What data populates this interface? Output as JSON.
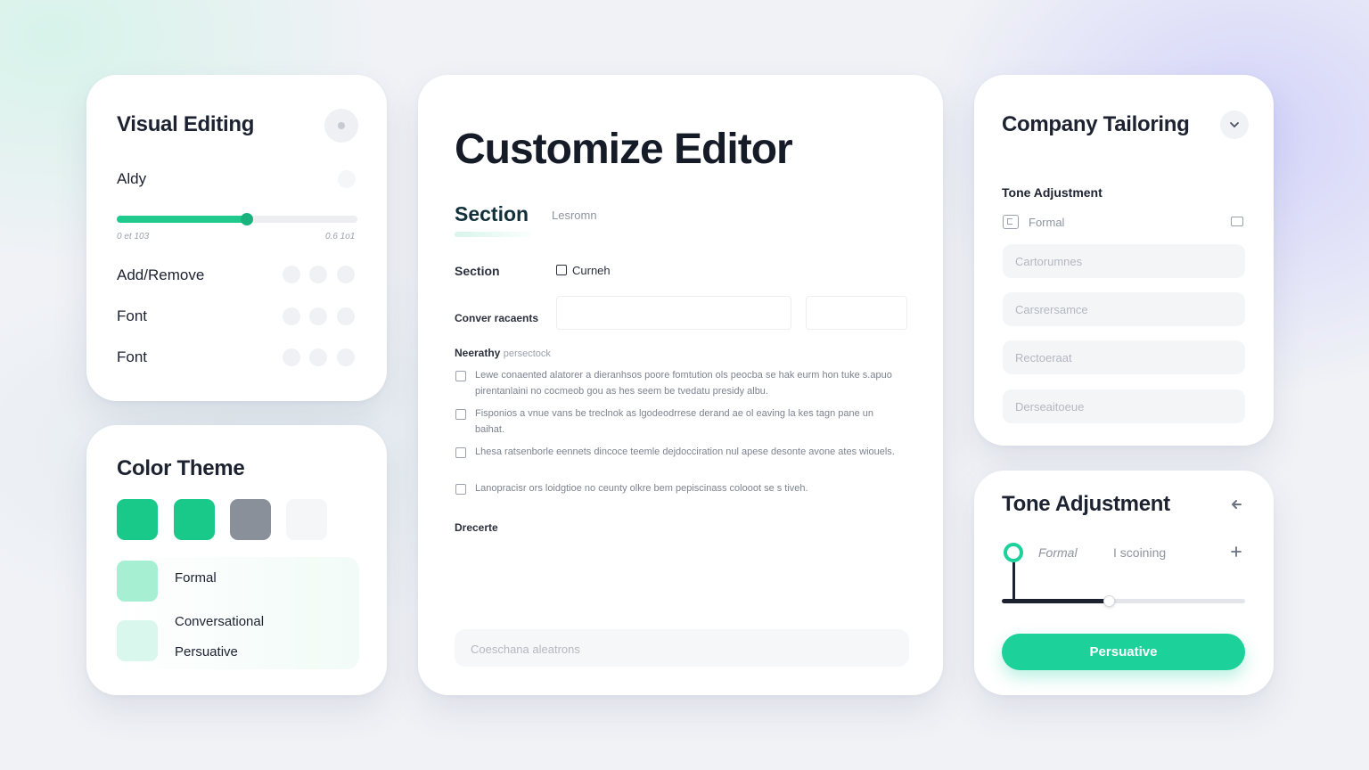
{
  "visual_editing": {
    "title": "Visual Editing",
    "ally_label": "Aldy",
    "slider": {
      "value_fraction": 0.54,
      "min_label": "0 et 103",
      "max_label": "0.6 1o1"
    },
    "rows": [
      {
        "label": "Add/Remove"
      },
      {
        "label": "Font"
      },
      {
        "label": "Font"
      }
    ]
  },
  "color_theme": {
    "title": "Color Theme",
    "swatches": [
      "#18c98a",
      "#18c98a",
      "#8a909a",
      "#f5f6f8"
    ],
    "tones": [
      {
        "label": "Formal",
        "color": "#a7efd3"
      },
      {
        "label": "Conversational",
        "color": "#d9f7ec"
      },
      {
        "label": "Persuative"
      }
    ]
  },
  "editor": {
    "title": "Customize Editor",
    "tab_active": "Section",
    "tab_inactive": "Lesromn",
    "section_label": "Section",
    "checkbox_label": "Curneh",
    "field_label": "Conver racaents",
    "nearby_label": "Neerathy",
    "nearby_sub": "persectock",
    "items": [
      "Lewe conaented alatorer a dieranhsos poore fomtution ols peocba se hak eurm hon tuke s.apuo pirentanlaini no cocmeob gou as hes seem be tvedatu presidy albu.",
      "Fisponios a vnue vans be treclnok as lgodeodrrese derand ae ol eaving la kes tagn pane un baihat.",
      "Lhesa ratsenborle eennets dincoce teemle dejdocciration nul apese desonte avone ates wiouels.",
      "Lanopracisr ors loidgtioe no ceunty olkre bem pepiscinass colooot se s tiveh."
    ],
    "footer_label": "Drecerte",
    "bottom_input_placeholder": "Coeschana aleatrons"
  },
  "company": {
    "title": "Company Tailoring",
    "section_label": "Tone Adjustment",
    "select_value": "Formal",
    "fields": [
      "Cartorumnes",
      "Carsrersamce",
      "Rectoeraat",
      "Derseaitoeue"
    ]
  },
  "tone": {
    "title": "Tone Adjustment",
    "option_left": "Formal",
    "option_right": "I scoining",
    "slider_fraction": 0.44,
    "button_label": "Persuative",
    "accent": "#1dd19a"
  }
}
